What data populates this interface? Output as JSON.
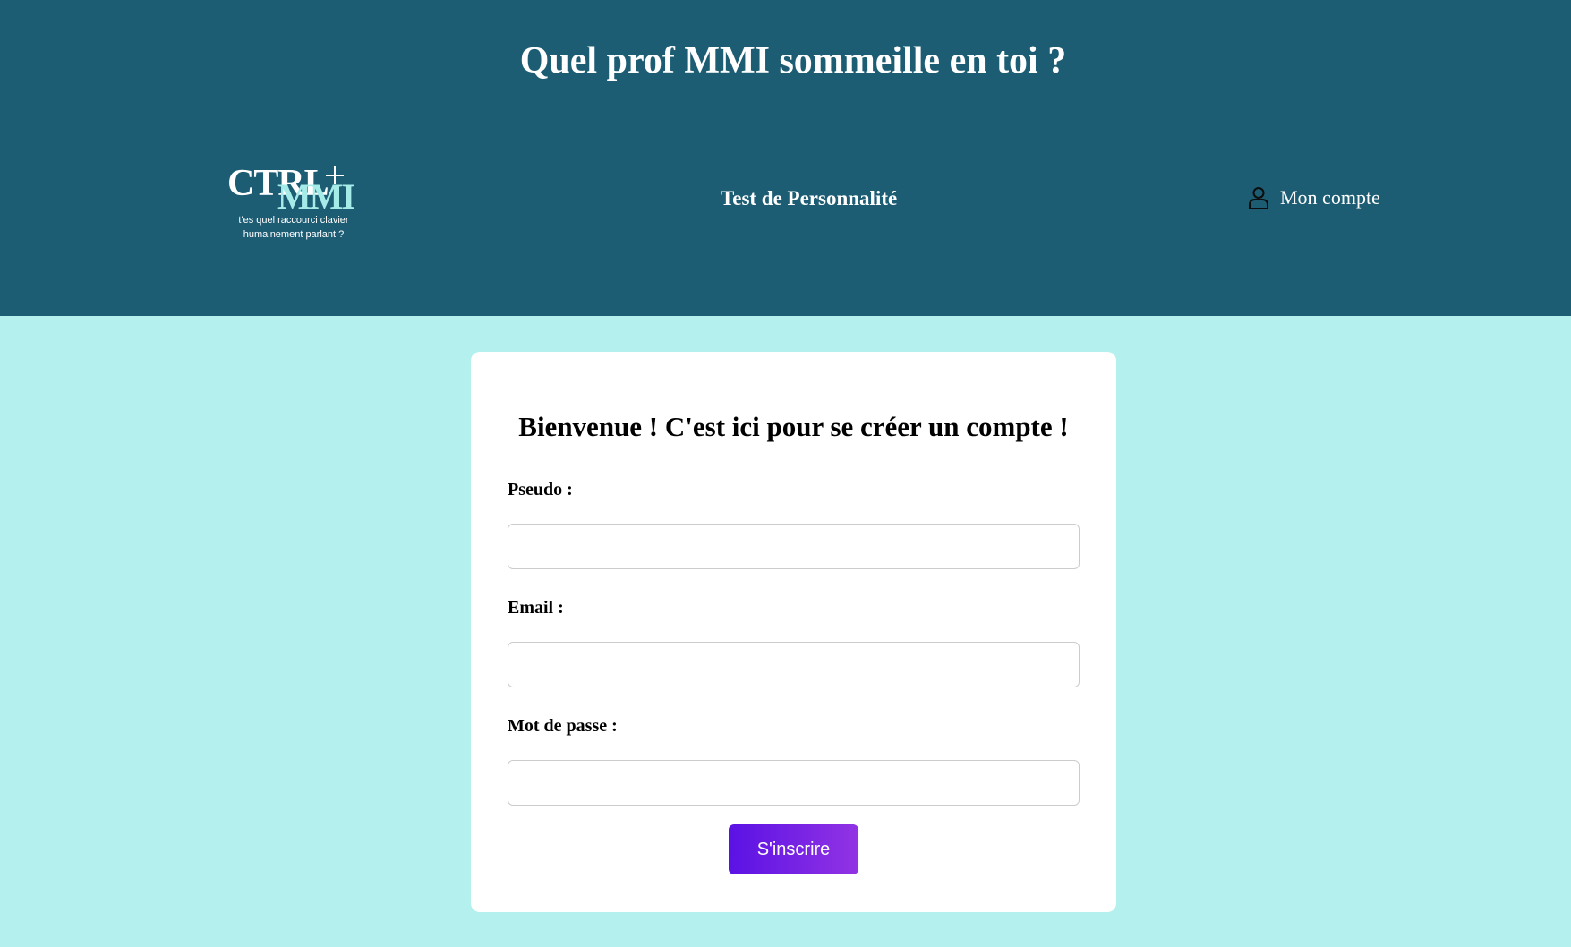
{
  "header": {
    "site_title": "Quel prof MMI sommeille en toi ?",
    "logo": {
      "ctrl": "CTRL",
      "mmi": "MMI",
      "tagline_line1": "t'es quel raccourci clavier",
      "tagline_line2": "humainement parlant ?"
    },
    "nav_link": "Test de Personnalité",
    "account": {
      "icon": "user-icon",
      "label": "Mon compte"
    }
  },
  "form": {
    "title": "Bienvenue ! C'est ici pour se créer un compte !",
    "fields": [
      {
        "label": "Pseudo :",
        "value": "",
        "placeholder": ""
      },
      {
        "label": "Email :",
        "value": "",
        "placeholder": ""
      },
      {
        "label": "Mot de passe :",
        "value": "",
        "placeholder": ""
      }
    ],
    "submit_label": "S'inscrire"
  },
  "colors": {
    "header_bg": "#1d5d74",
    "page_bg": "#b3f0ee",
    "card_bg": "#ffffff",
    "button_gradient_start": "#5a12e4",
    "button_gradient_end": "#9233e4"
  }
}
